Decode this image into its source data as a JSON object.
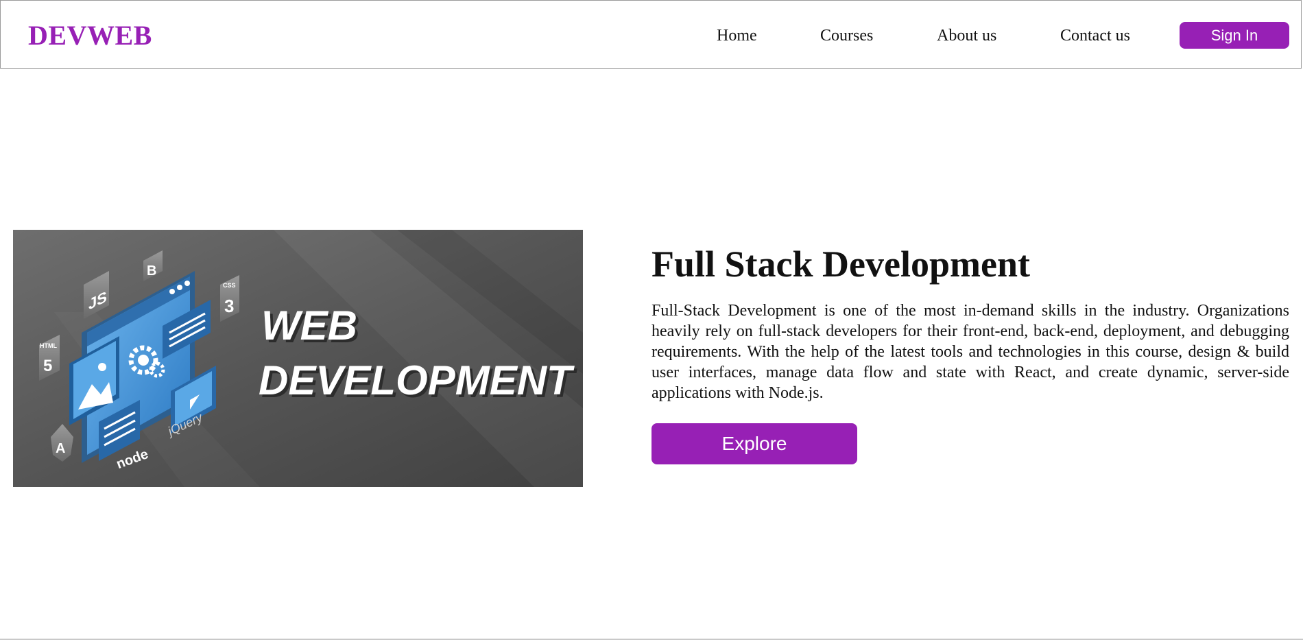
{
  "header": {
    "logo": "DEVWEB",
    "nav": [
      {
        "label": "Home"
      },
      {
        "label": "Courses"
      },
      {
        "label": "About us"
      },
      {
        "label": "Contact us"
      }
    ],
    "signin_label": "Sign In"
  },
  "hero": {
    "image": {
      "banner_line1": "WEB",
      "banner_line2": "DEVELOPMENT",
      "badges": [
        "JS",
        "B",
        "HTML",
        "5",
        "CSS",
        "3",
        "A",
        "node",
        "jQuery"
      ]
    },
    "title": "Full Stack Development",
    "description": "Full-Stack Development is one of the most in-demand skills in the industry. Organizations heavily rely on full-stack developers for their front-end, back-end, deployment, and debugging requirements. With the help of the latest tools and technologies in this course, design & build user interfaces, manage data flow and state with React, and create dynamic, server-side applications with Node.js.",
    "explore_label": "Explore"
  },
  "colors": {
    "brand": "#9720b5",
    "text": "#111111",
    "banner_bg": "#505050",
    "screen_blue": "#3f93d8"
  }
}
